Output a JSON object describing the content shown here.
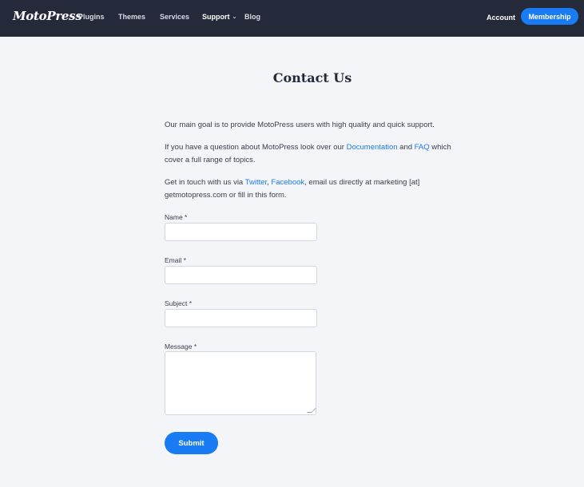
{
  "header": {
    "logo": "MotoPress",
    "nav": [
      {
        "label": "Plugins"
      },
      {
        "label": "Themes"
      },
      {
        "label": "Services"
      },
      {
        "label": "Support"
      },
      {
        "label": "Blog"
      }
    ],
    "account_label": "Account",
    "membership_label": "Membership"
  },
  "page": {
    "title": "Contact Us",
    "intro": "Our main goal is to provide MotoPress users with high quality and quick support.",
    "question": {
      "before": "If you have a question about MotoPress look over our ",
      "link1": "Documentation",
      "middle": " and ",
      "link2": "FAQ",
      "after": " which cover a full range of topics."
    },
    "contact": {
      "before": "Get in touch with us via ",
      "link1": "Twitter",
      "sep": ", ",
      "link2": "Facebook",
      "after": ", email us directly at marketing [at] getmotopress.com or fill in this form."
    }
  },
  "form": {
    "name_label": "Name *",
    "email_label": "Email *",
    "subject_label": "Subject *",
    "message_label": "Message *",
    "submit_label": "Submit"
  },
  "colors": {
    "header_bg": "#252a3b",
    "accent": "#1a7cf4",
    "page_bg": "#f3f5f8"
  }
}
